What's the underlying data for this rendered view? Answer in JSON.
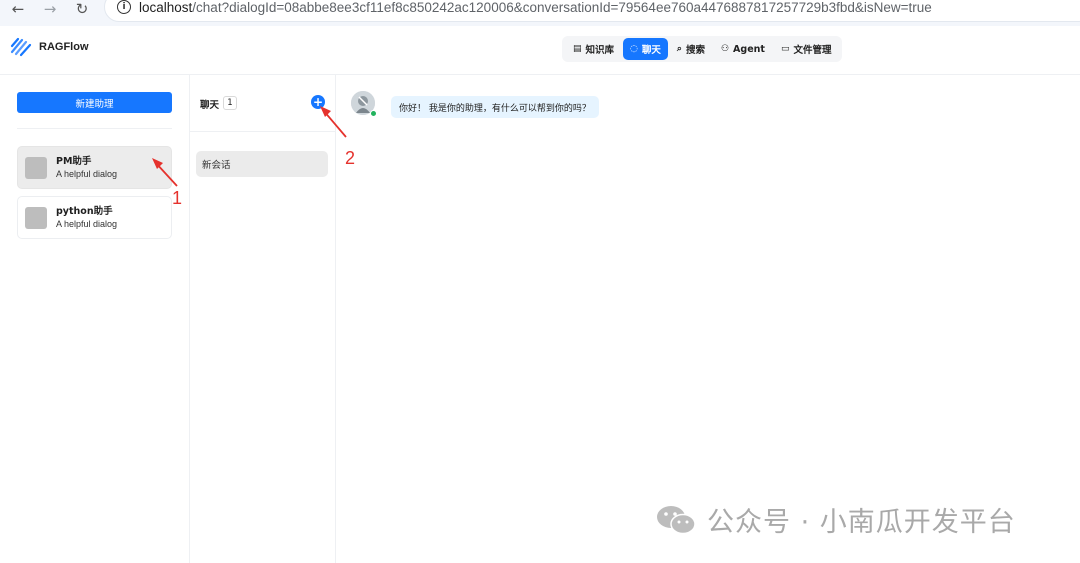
{
  "browser": {
    "back_icon": "arrow-left-icon",
    "forward_icon": "arrow-right-icon",
    "reload_icon": "reload-icon",
    "url_host": "localhost",
    "url_rest": "/chat?dialogId=08abbe8ee3cf11ef8c850242ac120006&conversationId=79564ee760a4476887817257729b3fbd&isNew=true"
  },
  "header": {
    "brand": "RAGFlow",
    "nav": [
      {
        "label": "知识库",
        "icon": "database-icon"
      },
      {
        "label": "聊天",
        "icon": "chat-icon",
        "active": true
      },
      {
        "label": "搜索",
        "icon": "search-icon"
      },
      {
        "label": "Agent",
        "icon": "agent-icon"
      },
      {
        "label": "文件管理",
        "icon": "folder-icon"
      }
    ]
  },
  "sidebar": {
    "new_button": "新建助理",
    "assistants": [
      {
        "name": "PM助手",
        "desc": "A helpful dialog",
        "selected": true
      },
      {
        "name": "python助手",
        "desc": "A helpful dialog"
      }
    ]
  },
  "conversations": {
    "title": "聊天",
    "count": "1",
    "add_icon": "plus-circle-icon",
    "items": [
      {
        "label": "新会话"
      }
    ]
  },
  "chat": {
    "greeting": "你好！ 我是你的助理，有什么可以帮到你的吗？"
  },
  "annotations": {
    "one": "1",
    "two": "2"
  },
  "watermark": {
    "text": "公众号 · 小南瓜开发平台"
  },
  "colors": {
    "primary": "#1677ff",
    "annotation": "#e5322d",
    "online": "#22b35e"
  }
}
